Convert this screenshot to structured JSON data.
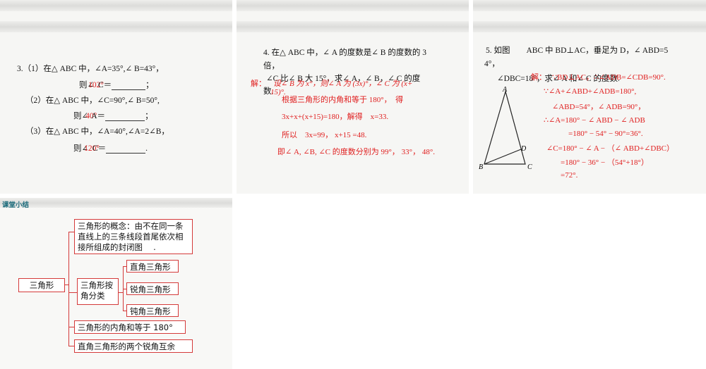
{
  "slide3": {
    "q1": "3.（1）在△ ABC 中，∠A=35°,∠ B=43°，",
    "q1_ans_pre": "则∠",
    "q1_red": "102°",
    "q1_tail": "C＝",
    "q1_end": "；",
    "q2": "（2）在△ ABC 中，∠C=90°,∠ B=50°,",
    "q2_ans_pre": "则∠",
    "q2_red": "40°",
    "q2_tail": "A＝",
    "q2_end": "；",
    "q3": "（3）在△ ABC 中，∠A=40°,∠A=2∠B，",
    "q3_ans_pre": "则∠",
    "q3_red": "120°",
    "q3_tail": "C＝",
    "q3_end": "."
  },
  "slide4": {
    "line1": "4. 在△ ABC 中，∠ A 的度数是∠ B 的度数的 3",
    "line2": "倍，",
    "line3": "∠C 比∠ B 大 15°，求∠ A，∠ B，∠ C 的度",
    "line4": "数.",
    "sol_label": "解：",
    "sol1": "设∠ B 为 x°，则∠ A 为 (3x)°，∠ C 为 (x+",
    "sol1b": "15)°.",
    "sol2": "根据三角形的内角和等于 180°，　得",
    "sol3": "3x+x+(x+15)=180，解得　x=33.",
    "sol4": "所以　3x=99，  x+15 =48.",
    "sol5": "即∠ A, ∠B, ∠C 的度数分别为 99°，  33°，  48°."
  },
  "slide5": {
    "line1": "5. 如图　　ABC 中 BD⊥AC，垂足为 D，∠ ABD=5",
    "line2": "4°，",
    "line3": "∠DBC=18°，求∠ A 和∠ C 的度数.",
    "sol_label": "解：",
    "sol1": "∵BD⊥AC，∴∠ADB=∠CDB=90°.",
    "sol2": "∵∠A+∠ABD+∠ADB=180°,",
    "sol3": "∠ABD=54°，∠ ADB=90°，",
    "sol4": "∴∠A=180° − ∠ ABD − ∠ ADB",
    "sol5": "=180° − 54° − 90°=36°.",
    "sol6": "∠C=180° − ∠ A − （∠ ABD+∠DBC）",
    "sol7": "=180° − 36° − （54°+18°）",
    "sol8": "=72°.",
    "labels": {
      "A": "A",
      "B": "B",
      "C": "C",
      "D": "D"
    }
  },
  "summary": {
    "title": "课堂小结",
    "root": "三角形",
    "concept": "三角形的概念：由不在同一条直线上的三条线段首尾依次相接所组成的封闭图　 .",
    "classify": "三角形按角分类",
    "right": "直角三角形",
    "acute": "锐角三角形",
    "obtuse": "钝角三角形",
    "angle_sum": "三角形的内角和等于 180°",
    "complement": "直角三角形的两个锐角互余"
  }
}
